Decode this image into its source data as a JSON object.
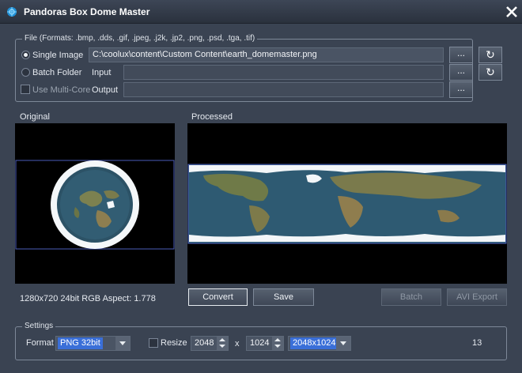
{
  "window": {
    "title": "Pandoras Box Dome Master"
  },
  "file_group": {
    "label": "File (Formats: .bmp, .dds, .gif, .jpeg, .j2k, .jp2, .png, .psd, .tga, .tif)",
    "single_image_label": "Single Image",
    "single_image_path": "C:\\coolux\\content\\Custom Content\\earth_domemaster.png",
    "batch_folder_label": "Batch Folder",
    "input_label": "Input",
    "input_value": "",
    "use_multicore_label": "Use Multi-Core",
    "output_label": "Output",
    "output_value": "",
    "browse_label": "...",
    "refresh_icon": "refresh-icon"
  },
  "original": {
    "label": "Original",
    "info": "1280x720 24bit RGB Aspect: 1.778"
  },
  "processed": {
    "label": "Processed"
  },
  "buttons": {
    "convert": "Convert",
    "save": "Save",
    "batch": "Batch",
    "avi_export": "AVI Export"
  },
  "settings": {
    "label": "Settings",
    "format_label": "Format",
    "format_value": "PNG 32bit",
    "resize_label": "Resize",
    "width": "2048",
    "x_sep": "x",
    "height": "1024",
    "size_preset": "2048x1024",
    "count": "13"
  },
  "colors": {
    "selection": "#3a6fd8",
    "background": "#3a4352"
  }
}
